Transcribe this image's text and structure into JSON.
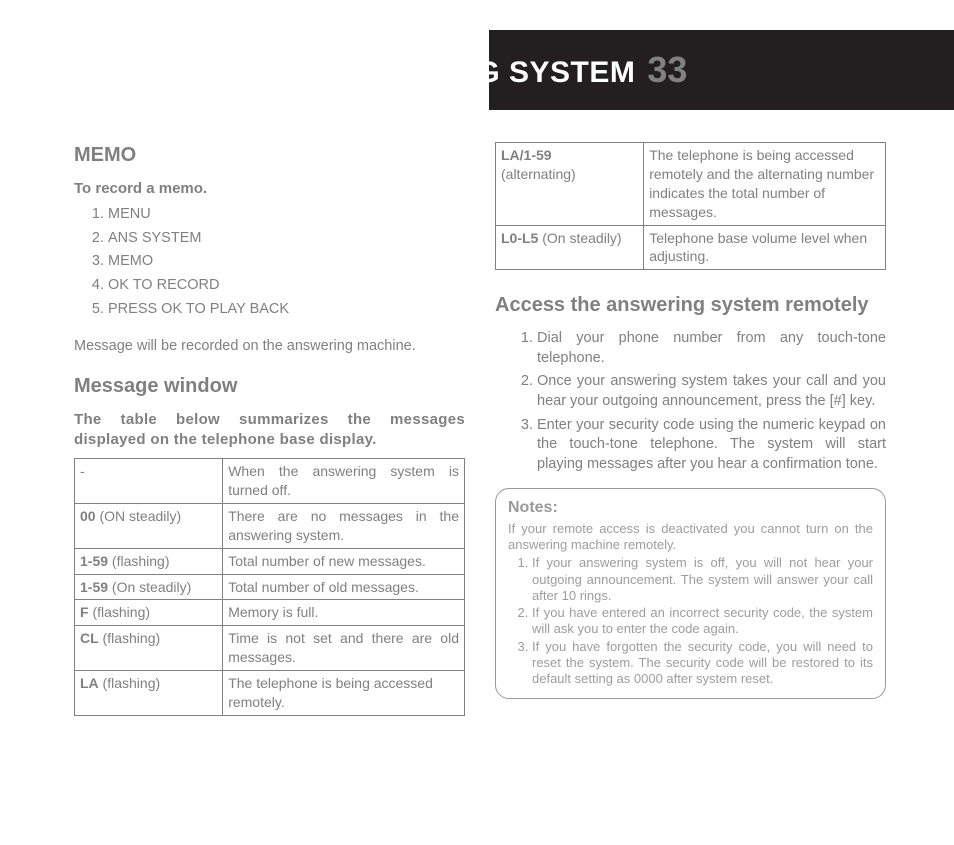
{
  "header": {
    "title": "ANSWERING SYSTEM",
    "page": "33"
  },
  "memo": {
    "heading": "MEMO",
    "subhead": "To record a memo.",
    "steps": [
      "MENU",
      "ANS SYSTEM",
      "MEMO",
      "OK TO RECORD",
      "PRESS OK TO PLAY BACK"
    ],
    "note": "Message will be recorded on the answering machine."
  },
  "msgwin": {
    "heading": "Message window",
    "subhead": "The table below summarizes the messages displayed on the telephone base display.",
    "rows": [
      {
        "code": "-",
        "state": "",
        "desc": "When the answering system is turned off."
      },
      {
        "code": "00",
        "state": " (ON steadily)",
        "desc": "There are no messages in the answering system."
      },
      {
        "code": "1-59",
        "state": " (flashing)",
        "desc": "Total number of new messages."
      },
      {
        "code": "1-59",
        "state": " (On steadily)",
        "desc": "Total number of old messages."
      },
      {
        "code": "F",
        "state": " (flashing)",
        "desc": "Memory is full."
      },
      {
        "code": "CL",
        "state": " (flashing)",
        "desc": "Time is not set and there are old messages."
      },
      {
        "code": "LA",
        "state": " (flashing)",
        "desc": "The telephone is being accessed remotely."
      }
    ]
  },
  "msgwin2": {
    "rows": [
      {
        "code": "LA/1-59",
        "state": "(alternating)",
        "desc": "The telephone is being accessed remotely and the alternating number indicates the total number of messages."
      },
      {
        "code": "L0-L5",
        "state": " (On steadily)",
        "desc": "Telephone base volume level when adjusting."
      }
    ]
  },
  "access": {
    "heading": "Access the answering system remotely",
    "steps": [
      "Dial your phone number from any touch-tone telephone.",
      "Once your answering system takes your call and you hear your outgoing announcement, press the [#] key.",
      "Enter your security code using the numeric keypad on the touch-tone telephone. The system will start playing messages after you hear a confirmation tone."
    ]
  },
  "notes": {
    "title": "Notes:",
    "intro": "If your remote access is deactivated you cannot turn on the answering machine remotely.",
    "items": [
      "If your answering system is off, you will not hear your outgoing announcement. The system will answer your call after 10 rings.",
      "If you have entered an incorrect security code, the system will ask you to enter the code again.",
      "If you have forgotten the security code, you will need to reset the system. The security code will be restored to its default setting as 0000 after system reset."
    ]
  }
}
